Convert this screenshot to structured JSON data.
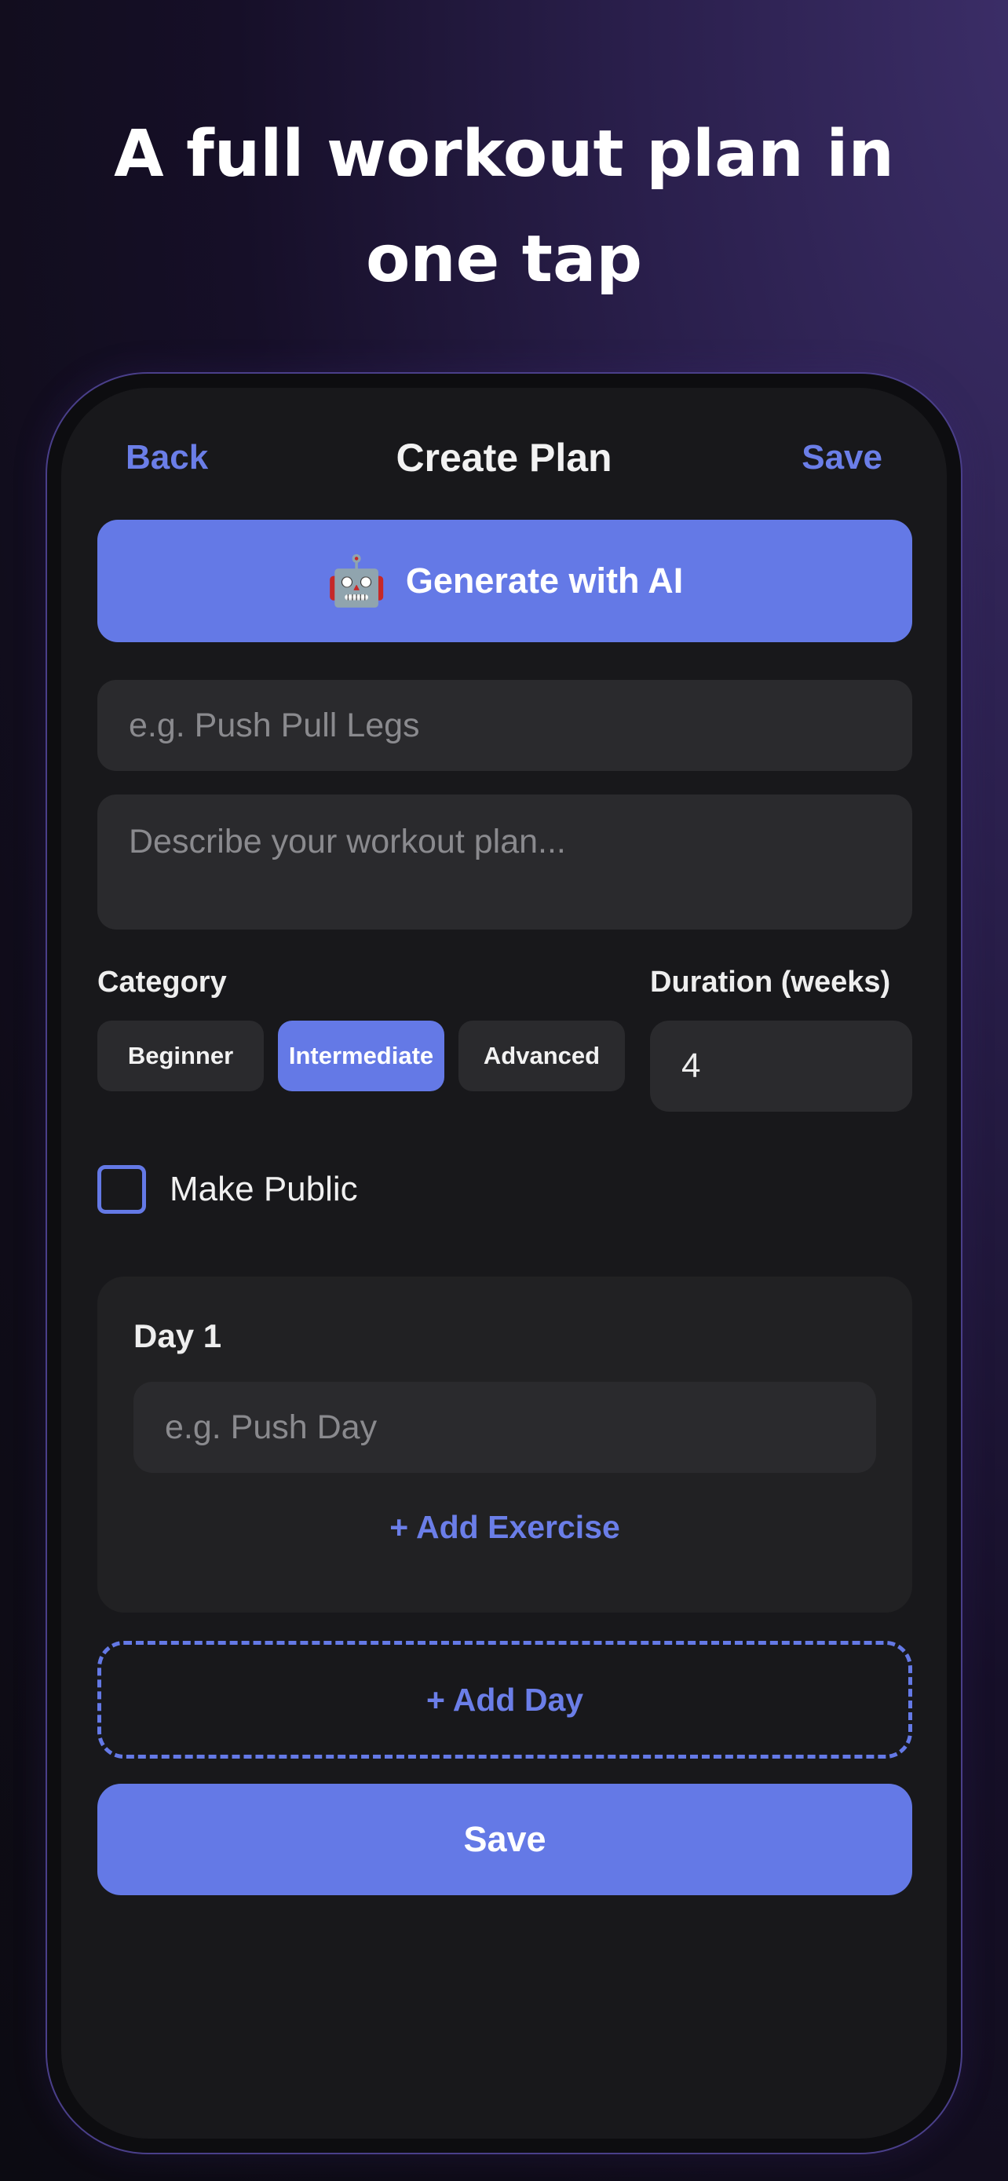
{
  "headline": "A full workout plan in one tap",
  "nav": {
    "back_label": "Back",
    "title": "Create Plan",
    "save_label": "Save"
  },
  "ai_button": {
    "icon": "🤖",
    "label": "Generate with AI"
  },
  "plan_name": {
    "value": "",
    "placeholder": "e.g. Push Pull Legs"
  },
  "description": {
    "value": "",
    "placeholder": "Describe your workout plan..."
  },
  "category": {
    "label": "Category",
    "options": [
      "Beginner",
      "Intermediate",
      "Advanced"
    ],
    "selected": "Intermediate"
  },
  "duration": {
    "label": "Duration (weeks)",
    "value": "4"
  },
  "make_public": {
    "label": "Make Public",
    "checked": false
  },
  "days": [
    {
      "title": "Day 1",
      "name_placeholder": "e.g. Push Day",
      "add_exercise_label": "+ Add Exercise"
    }
  ],
  "add_day_label": "+ Add Day",
  "save_button_label": "Save",
  "colors": {
    "accent": "#6479e6",
    "surface": "#18181b",
    "field": "#2a2a2d",
    "card": "#212123"
  }
}
